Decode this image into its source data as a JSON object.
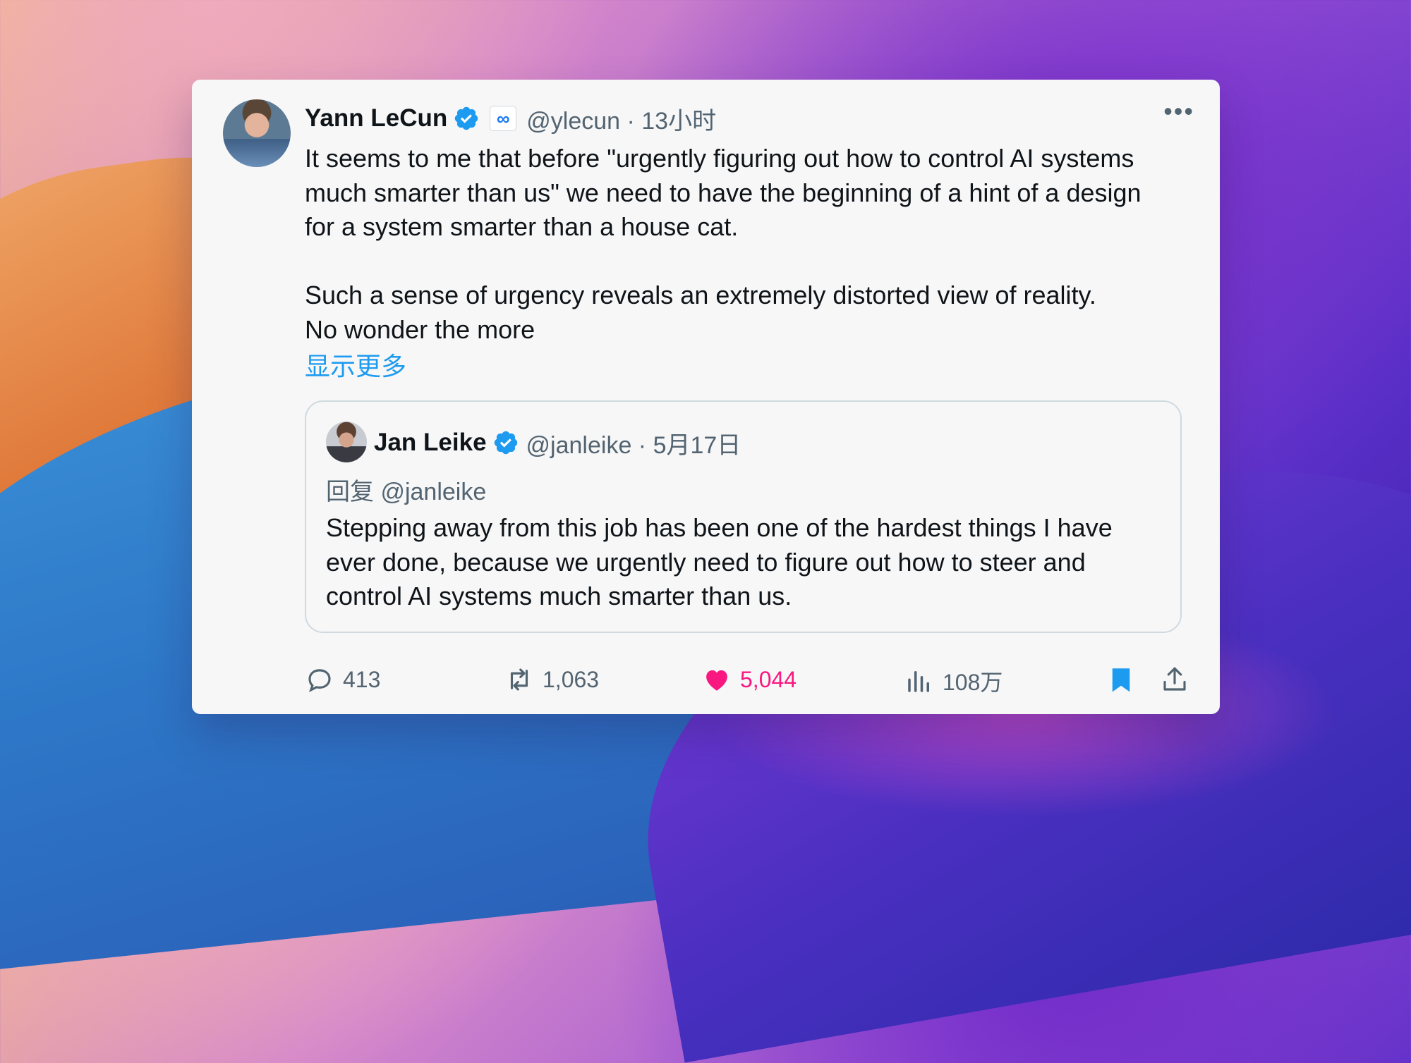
{
  "tweet": {
    "author_name": "Yann LeCun",
    "handle_time": "@ylecun · 13小时",
    "meta_badge": "∞",
    "more": "•••",
    "lines": [
      "It seems to me that before \"urgently figuring out how to control AI systems",
      "much smarter than us\" we need to have the beginning of a hint of a design",
      "for a system smarter than a house cat.",
      "",
      "Such a sense of urgency reveals an extremely distorted view of reality.",
      "No wonder the more"
    ],
    "show_more": "显示更多"
  },
  "quote": {
    "author_name": "Jan Leike",
    "handle_date": "@janleike · 5月17日",
    "reply_to": "回复 @janleike",
    "lines": [
      "Stepping away from this job has been one of the hardest things I have",
      "ever done, because we urgently need to figure out how to steer and",
      "control AI systems much smarter than us."
    ]
  },
  "actions": {
    "replies": "413",
    "reposts": "1,063",
    "likes": "5,044",
    "views": "108万"
  },
  "colors": {
    "accent": "#1d9bf0",
    "like": "#f91880",
    "muted": "#536471",
    "text": "#0f1419"
  }
}
